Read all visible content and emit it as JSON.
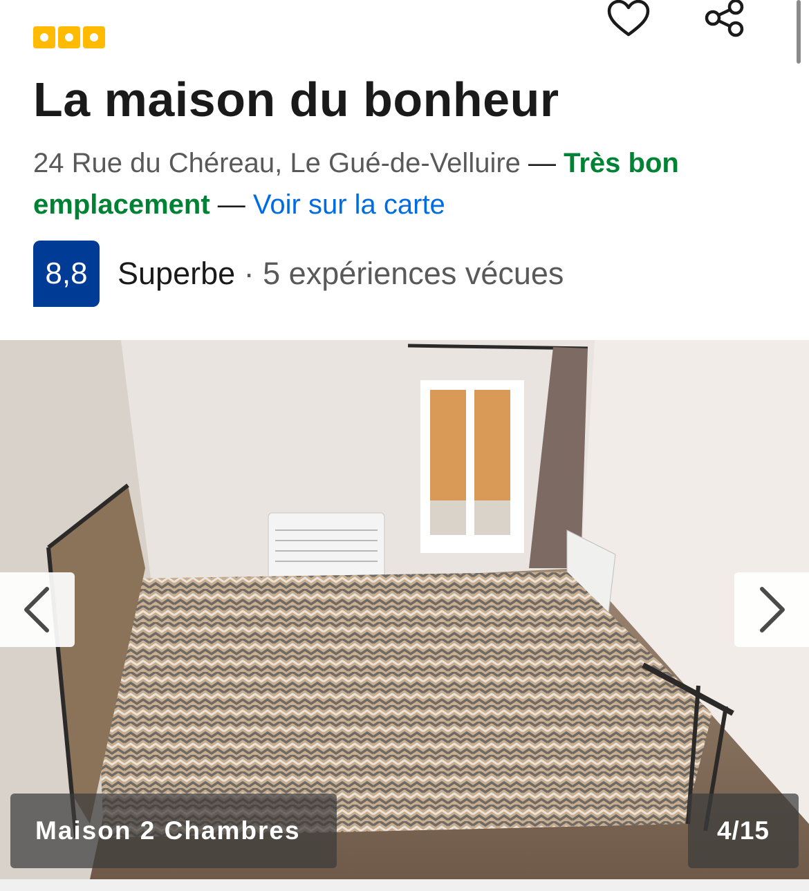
{
  "hotel": {
    "star_rating": 3,
    "name": "La maison du bonheur",
    "address": "24 Rue du Chéreau, Le Gué-de-Velluire",
    "separator": " — ",
    "location_rating": "Très bon emplacement",
    "map_link": "Voir sur la carte"
  },
  "review": {
    "score": "8,8",
    "label": "Superbe",
    "dot": " · ",
    "count_text": "5 expériences vécues"
  },
  "gallery": {
    "caption": "Maison 2 Chambres",
    "counter": "4/15"
  },
  "icons": {
    "favorite": "heart-icon",
    "share": "share-icon",
    "prev": "chevron-left-icon",
    "next": "chevron-right-icon"
  },
  "colors": {
    "star_badge": "#febb02",
    "score_badge": "#003b95",
    "location_green": "#008234",
    "link_blue": "#006ce4"
  }
}
